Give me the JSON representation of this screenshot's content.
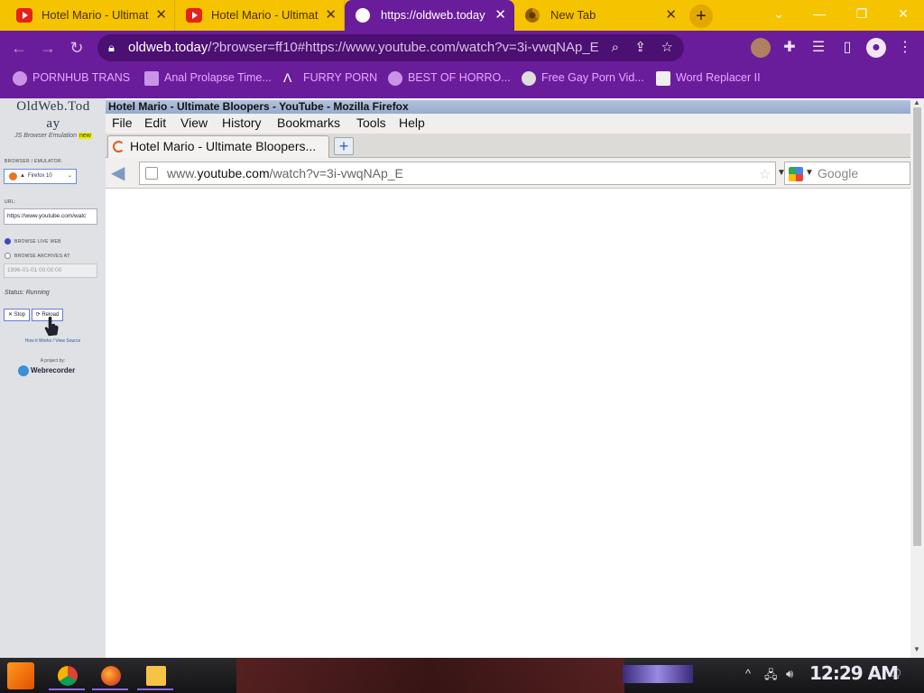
{
  "chrome": {
    "tabs": [
      {
        "title": "Hotel Mario - Ultimat",
        "icon": "youtube-icon"
      },
      {
        "title": "Hotel Mario - Ultimat",
        "icon": "youtube-icon"
      },
      {
        "title": "https://oldweb.today",
        "icon": "oldweb-icon"
      },
      {
        "title": "New Tab",
        "icon": "chrome-icon"
      }
    ],
    "new_tab": "+",
    "omnibox_host": "oldweb.today",
    "omnibox_rest": "/?browser=ff10#https://www.youtube.com/watch?v=3i-vwqNAp_E",
    "bookmarks": [
      {
        "label": "PORNHUB TRANS"
      },
      {
        "label": "Anal Prolapse Time..."
      },
      {
        "label": "FURRY PORN"
      },
      {
        "label": "BEST OF HORRO..."
      },
      {
        "label": "Free Gay Porn Vid..."
      },
      {
        "label": "Word Replacer II"
      }
    ],
    "accent": "#6a1d9a",
    "tabstrip_color": "#f5c300"
  },
  "oldweb": {
    "logo_line1": "OldWeb.Tod",
    "logo_line2": "ay",
    "subtitle": "JS Browser Emulation",
    "new_badge": "new",
    "browser_label": "BROWSER / EMULATOR:",
    "browser_value": "Firefox 10",
    "url_label": "URL:",
    "url_value": "https://www.youtube.com/watc",
    "live_label": "BROWSE LIVE WEB",
    "archive_label": "BROWSE ARCHIVES AT:",
    "date_value": "1996-01-01 00:00:00",
    "status": "Status: Running",
    "stop_label": "✕ Stop",
    "reload_label": "⟳ Reload",
    "how_link": "How it Works / View Source",
    "project_label": "A project by:",
    "webrecorder": "Webrecorder"
  },
  "firefox": {
    "window_title": "Hotel Mario - Ultimate Bloopers - YouTube - Mozilla Firefox",
    "menu": [
      "File",
      "Edit",
      "View",
      "History",
      "Bookmarks",
      "Tools",
      "Help"
    ],
    "tab_title": "Hotel Mario - Ultimate Bloopers...",
    "url_prefix": "www.",
    "url_domain": "youtube.com",
    "url_path": "/watch?v=3i-vwqNAp_E",
    "search_placeholder": "Google"
  },
  "taskbar": {
    "clock": "12:29 AM"
  }
}
